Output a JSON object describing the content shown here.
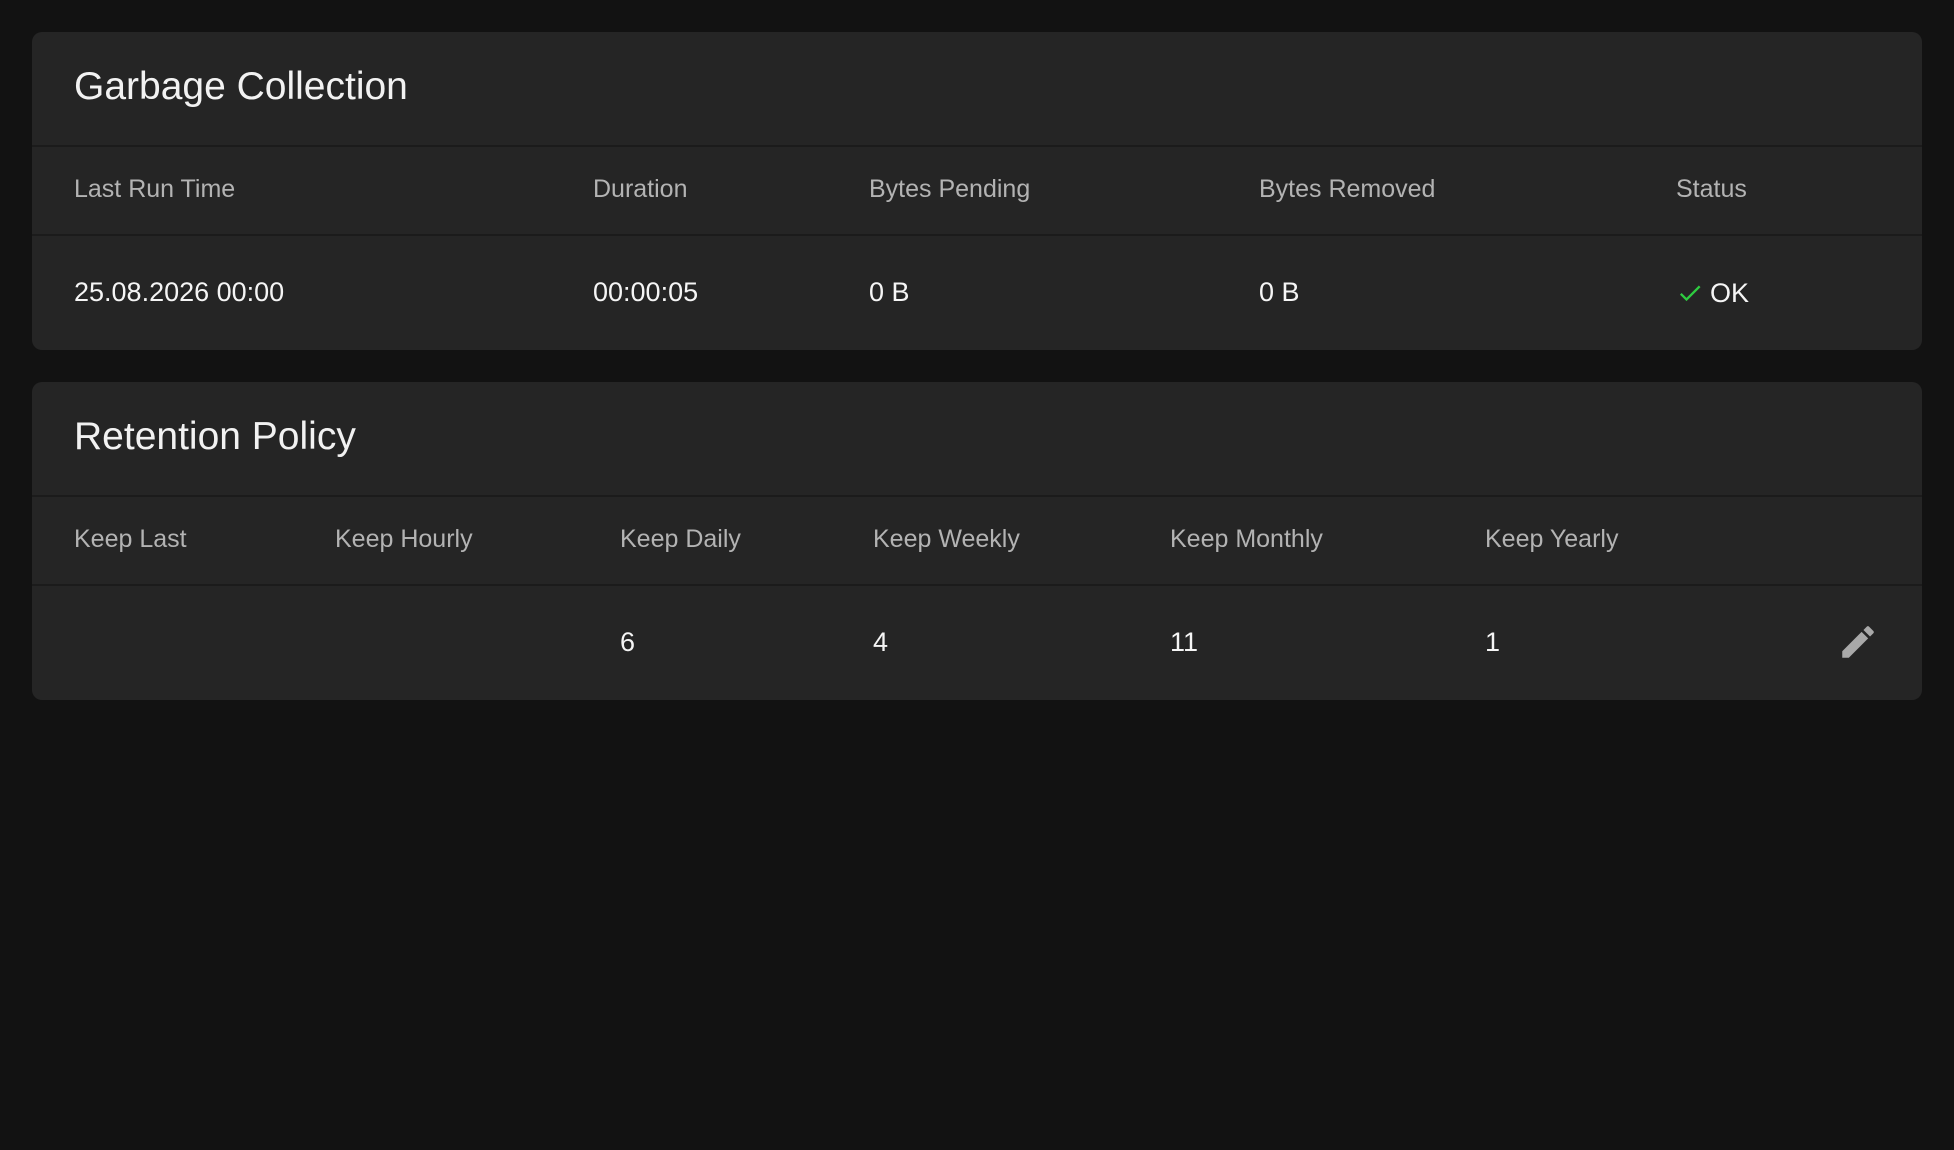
{
  "garbage_collection": {
    "title": "Garbage Collection",
    "headers": [
      "Last Run Time",
      "Duration",
      "Bytes Pending",
      "Bytes Removed",
      "Status"
    ],
    "row": {
      "last_run_time": "25.08.2026 00:00",
      "duration": "00:00:05",
      "bytes_pending": "0 B",
      "bytes_removed": "0 B",
      "status": "OK",
      "status_icon": "check-icon",
      "status_color": "#2ecc40"
    }
  },
  "retention_policy": {
    "title": "Retention Policy",
    "headers": [
      "Keep Last",
      "Keep Hourly",
      "Keep Daily",
      "Keep Weekly",
      "Keep Monthly",
      "Keep Yearly"
    ],
    "row": {
      "keep_last": "",
      "keep_hourly": "",
      "keep_daily": "6",
      "keep_weekly": "4",
      "keep_monthly": "11",
      "keep_yearly": "1"
    },
    "edit_icon": "pencil-icon"
  },
  "colors": {
    "background": "#121212",
    "card": "#252525",
    "header_text": "#b3b3b3",
    "value_text": "#f5f5f5",
    "icon_gray": "#a9a9a9"
  }
}
